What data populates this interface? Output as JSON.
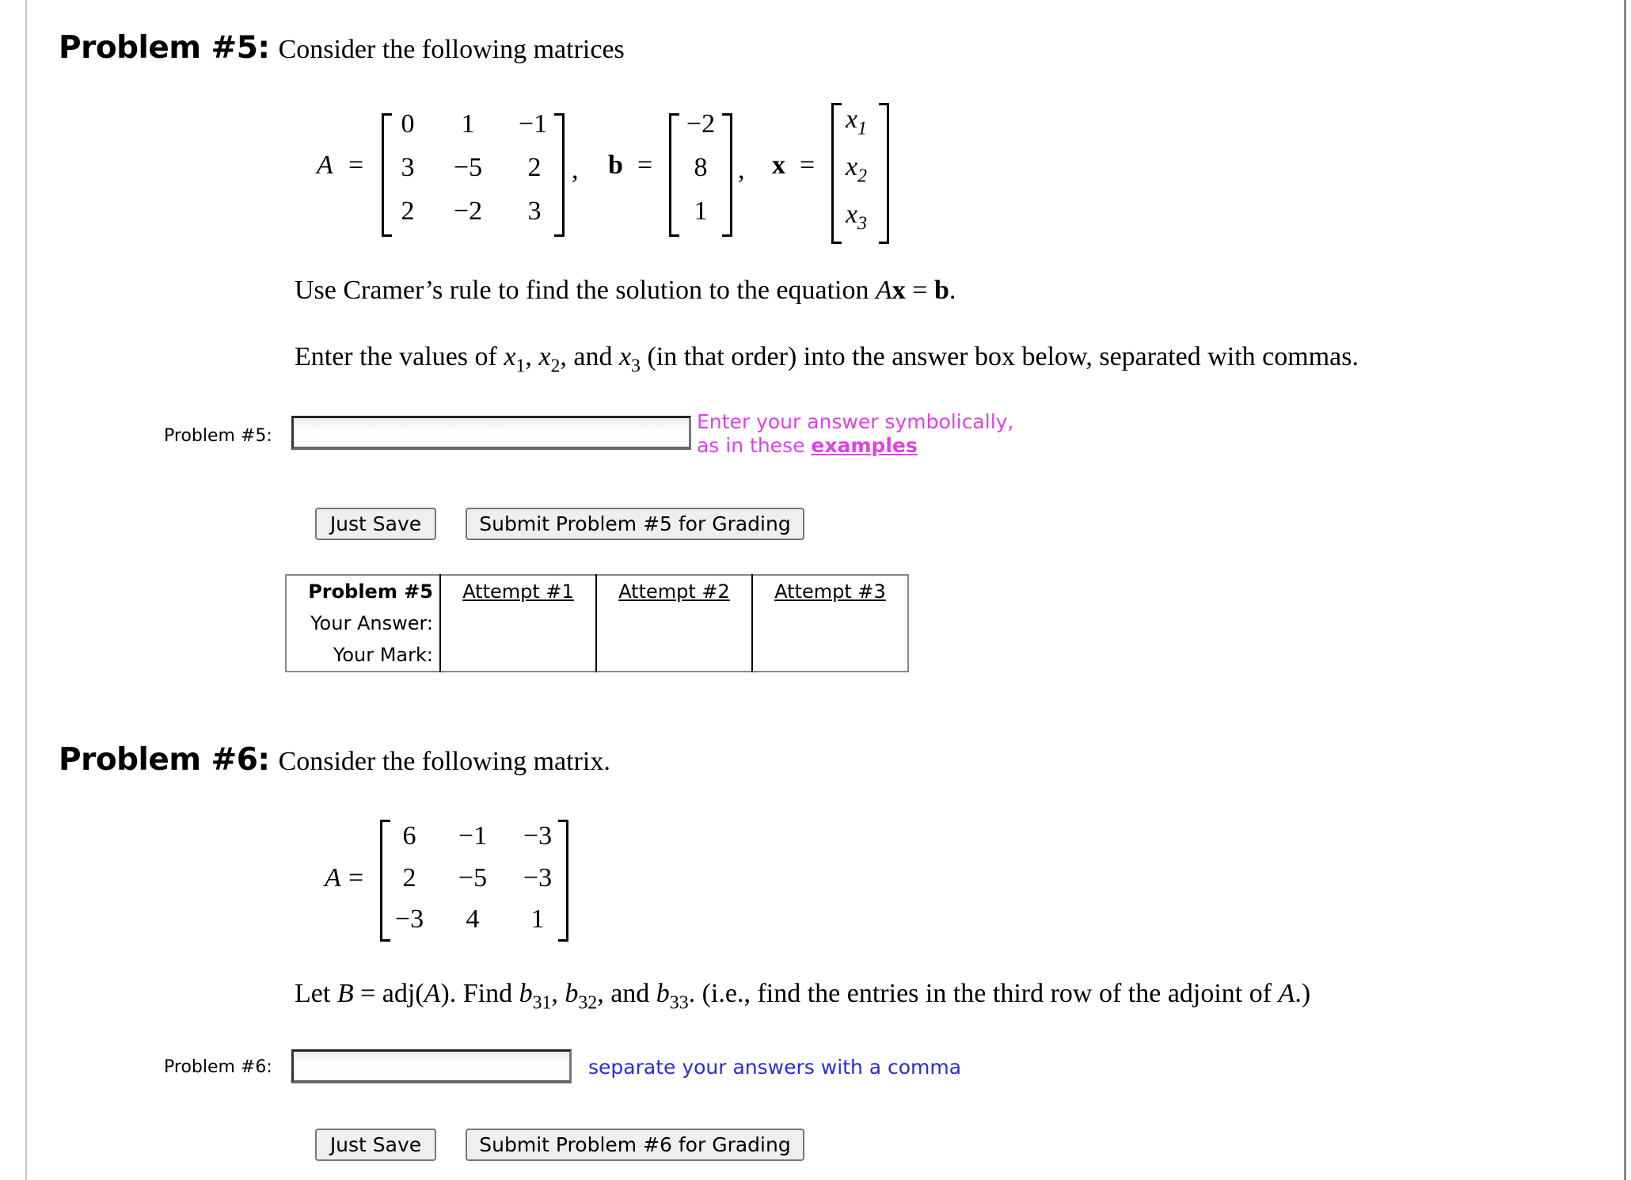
{
  "problems": [
    {
      "heading": "Problem #5:",
      "intro": "Consider the following matrices",
      "matrix_A": {
        "name": "A",
        "rows": [
          [
            "0",
            "1",
            "−1"
          ],
          [
            "3",
            "−5",
            "2"
          ],
          [
            "2",
            "−2",
            "3"
          ]
        ]
      },
      "vector_b": {
        "name": "b",
        "rows": [
          "−2",
          "8",
          "1"
        ]
      },
      "vector_x": {
        "name": "x",
        "rows": [
          "x",
          "x",
          "x"
        ],
        "subscripts": [
          "1",
          "2",
          "3"
        ]
      },
      "instruction_1": {
        "pre": "Use Cramer’s rule to find the solution to the equation ",
        "A": "A",
        "x": "x",
        "eq": " = ",
        "b": "b",
        "end": "."
      },
      "instruction_2": {
        "pre": "Enter the values of ",
        "v1": "x",
        "s1": "1",
        "sep1": ", ",
        "v2": "x",
        "s2": "2",
        "sep2": ", and ",
        "v3": "x",
        "s3": "3",
        "post": " (in that order) into the answer box below, separated with commas."
      },
      "answer_label": "Problem #5:",
      "answer_value": "",
      "hint_line1": "Enter your answer symbolically,",
      "hint_line2_pre": "as in these ",
      "hint_link": "examples",
      "hint_color": "#e041e6",
      "just_save": "Just Save",
      "submit": "Submit Problem #5 for Grading",
      "attempts_table": {
        "header": "Problem #5",
        "row_labels": [
          "Your Answer:",
          "Your Mark:"
        ],
        "attempts": [
          "Attempt #1",
          "Attempt #2",
          "Attempt #3"
        ],
        "answers": [
          "",
          "",
          ""
        ],
        "marks": [
          "",
          "",
          ""
        ]
      }
    },
    {
      "heading": "Problem #6:",
      "intro": "Consider the following matrix.",
      "matrix_A": {
        "name": "A",
        "rows": [
          [
            "6",
            "−1",
            "−3"
          ],
          [
            "2",
            "−5",
            "−3"
          ],
          [
            "−3",
            "4",
            "1"
          ]
        ]
      },
      "instruction": {
        "pre": "Let ",
        "B": "B",
        "mid1": " = adj(",
        "A": "A",
        "mid2": "). Find ",
        "b": "b",
        "s1": "31",
        "s2": "32",
        "s3": "33",
        "sep1": ", ",
        "sep2": ", and ",
        "post": ". (i.e., find the entries in the third row of the adjoint of ",
        "A2": "A",
        "end": ".)"
      },
      "answer_label": "Problem #6:",
      "answer_value": "",
      "hint": "separate your answers with a comma",
      "hint_color": "#2a2adc",
      "just_save": "Just Save",
      "submit": "Submit Problem #6 for Grading"
    }
  ]
}
